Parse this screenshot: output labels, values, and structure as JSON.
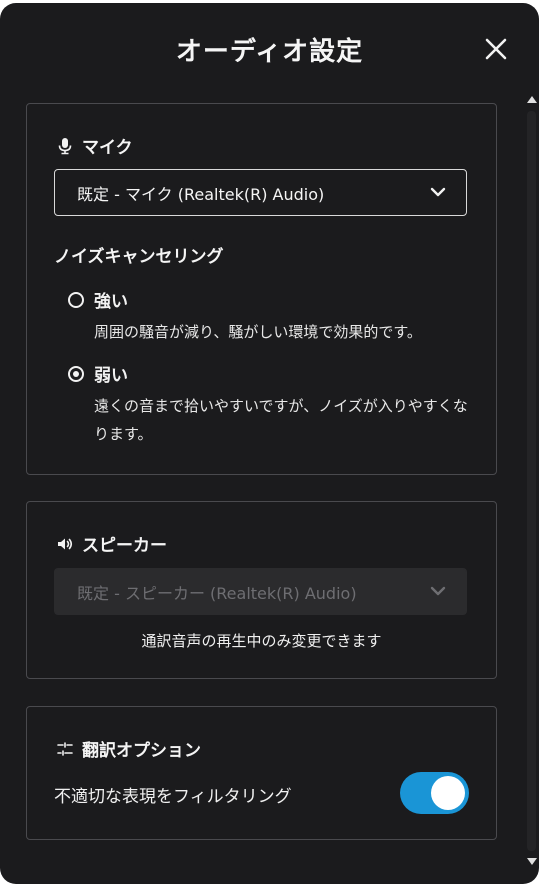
{
  "dialog": {
    "title": "オーディオ設定",
    "close_icon": "close-icon"
  },
  "mic": {
    "header": "マイク",
    "icon": "microphone-icon",
    "select_value": "既定 - マイク (Realtek(R) Audio)",
    "noise_cancel_label": "ノイズキャンセリング",
    "options": [
      {
        "label": "強い",
        "description": "周囲の騒音が減り、騒がしい環境で効果的です。",
        "selected": false
      },
      {
        "label": "弱い",
        "description": "遠くの音まで拾いやすいですが、ノイズが入りやすくなります。",
        "selected": true
      }
    ]
  },
  "speaker": {
    "header": "スピーカー",
    "icon": "speaker-icon",
    "select_value": "既定 - スピーカー (Realtek(R) Audio)",
    "note": "通訳音声の再生中のみ変更できます"
  },
  "options": {
    "header": "翻訳オプション",
    "icon": "sliders-icon",
    "filter_label": "不適切な表現をフィルタリング",
    "filter_enabled": true
  },
  "colors": {
    "background": "#1b1b1d",
    "border": "#4a4a4e",
    "accent": "#1a95d6"
  }
}
